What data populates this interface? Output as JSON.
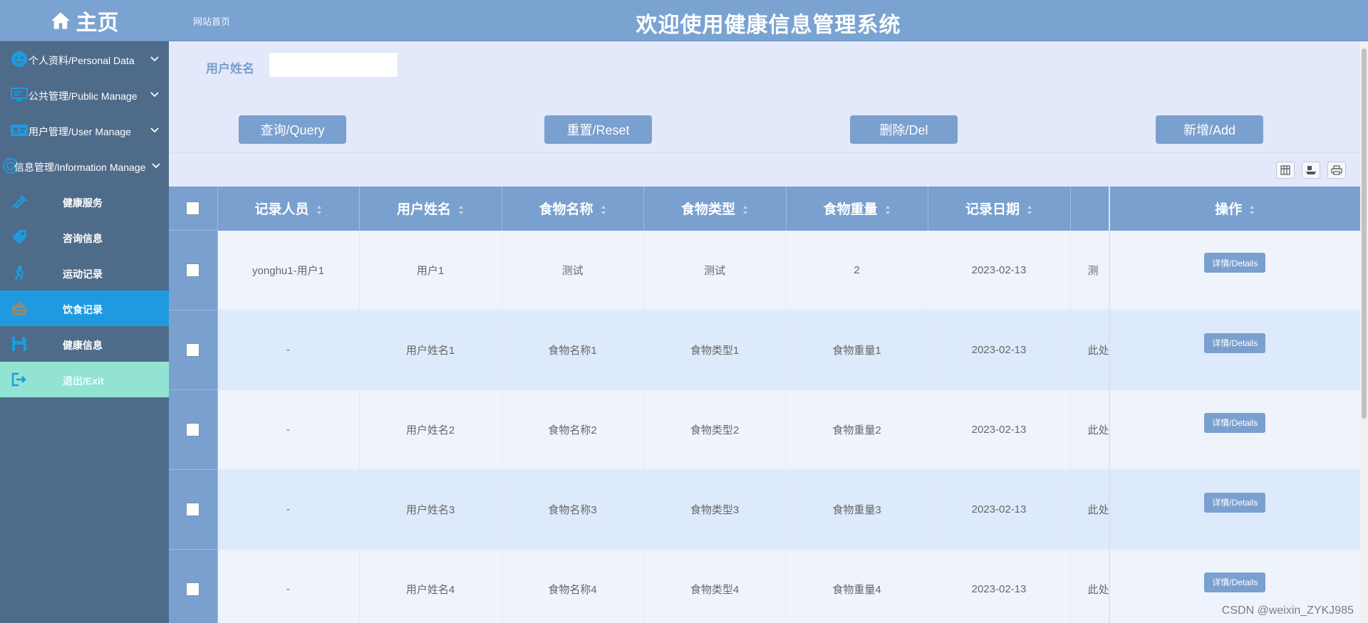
{
  "brand": {
    "title": "主页"
  },
  "header": {
    "breadcrumb": "网站首页",
    "site_title": "欢迎使用健康信息管理系统"
  },
  "sidebar": {
    "items": [
      {
        "label": "个人资料/Personal Data",
        "type": "group",
        "icon": "face-icon"
      },
      {
        "label": "公共管理/Public Manage",
        "type": "group",
        "icon": "monitor-icon"
      },
      {
        "label": "用户管理/User Manage",
        "type": "group",
        "icon": "id-card-icon"
      },
      {
        "label": "信息管理/Information Manage",
        "type": "group",
        "icon": "info-circle-icon"
      },
      {
        "label": "健康服务",
        "type": "sub",
        "icon": "syringe-icon"
      },
      {
        "label": "咨询信息",
        "type": "sub",
        "icon": "tag-icon"
      },
      {
        "label": "运动记录",
        "type": "sub",
        "icon": "runner-icon"
      },
      {
        "label": "饮食记录",
        "type": "sub",
        "icon": "notice-board-icon",
        "active": true
      },
      {
        "label": "健康信息",
        "type": "sub",
        "icon": "save-icon"
      },
      {
        "label": "退出/Exit",
        "type": "exit",
        "icon": "logout-icon"
      }
    ]
  },
  "search": {
    "label": "用户姓名",
    "value": "",
    "placeholder": ""
  },
  "buttons": {
    "query": "查询/Query",
    "reset": "重置/Reset",
    "delete": "删除/Del",
    "add": "新增/Add"
  },
  "toolbar": {
    "icons": [
      "columns-icon",
      "export-icon",
      "print-icon"
    ]
  },
  "table": {
    "columns": [
      "记录人员",
      "用户姓名",
      "食物名称",
      "食物类型",
      "食物重量",
      "记录日期",
      "",
      "操作"
    ],
    "rows": [
      [
        "yonghu1-用户1",
        "用户1",
        "测试",
        "测试",
        "2",
        "2023-02-13",
        "测"
      ],
      [
        "-",
        "用户姓名1",
        "食物名称1",
        "食物类型1",
        "食物重量1",
        "2023-02-13",
        "此处"
      ],
      [
        "-",
        "用户姓名2",
        "食物名称2",
        "食物类型2",
        "食物重量2",
        "2023-02-13",
        "此处"
      ],
      [
        "-",
        "用户姓名3",
        "食物名称3",
        "食物类型3",
        "食物重量3",
        "2023-02-13",
        "此处"
      ],
      [
        "-",
        "用户姓名4",
        "食物名称4",
        "食物类型4",
        "食物重量4",
        "2023-02-13",
        "此处"
      ]
    ],
    "details_label": "详情/Details"
  },
  "watermark": "CSDN @weixin_ZYKJ985",
  "colors": {
    "sidebar": "#4f6b8a",
    "header": "#7aa3d2",
    "active": "#1e9be0",
    "exit": "#93e3d3",
    "button": "#79a0cf",
    "page_bg": "#e3e9fb"
  }
}
